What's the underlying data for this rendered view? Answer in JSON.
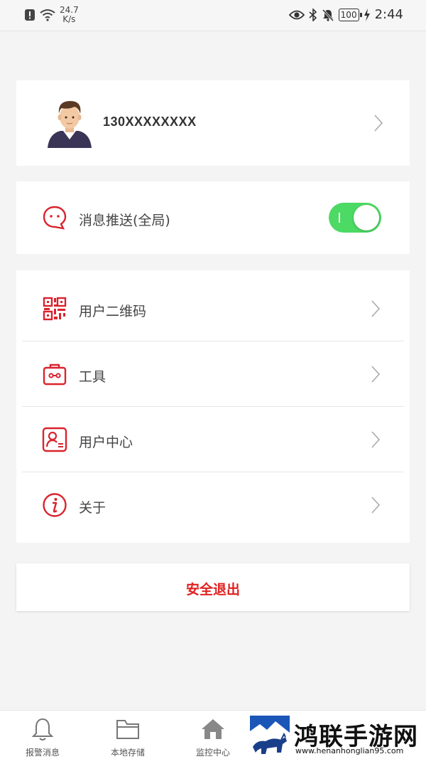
{
  "status_bar": {
    "net_speed_value": "24.7",
    "net_speed_unit": "K/s",
    "battery": "100",
    "time": "2:44"
  },
  "profile": {
    "phone": "130XXXXXXXX"
  },
  "push": {
    "label": "消息推送(全局)",
    "enabled": true
  },
  "menu": {
    "items": [
      {
        "label": "用户二维码",
        "icon": "qr-code-icon"
      },
      {
        "label": "工具",
        "icon": "toolbox-icon"
      },
      {
        "label": "用户中心",
        "icon": "user-card-icon"
      },
      {
        "label": "关于",
        "icon": "info-icon"
      }
    ]
  },
  "logout": {
    "label": "安全退出"
  },
  "tabbar": {
    "tabs": [
      {
        "label": "报警消息",
        "icon": "bell-icon"
      },
      {
        "label": "本地存储",
        "icon": "folder-icon"
      },
      {
        "label": "监控中心",
        "icon": "home-icon"
      }
    ]
  },
  "watermark": {
    "title": "鸿联手游网",
    "url": "www.henanhonglian95.com"
  },
  "colors": {
    "accent": "#d9232d",
    "toggle_on": "#4cd964",
    "logout_text": "#e02020"
  }
}
